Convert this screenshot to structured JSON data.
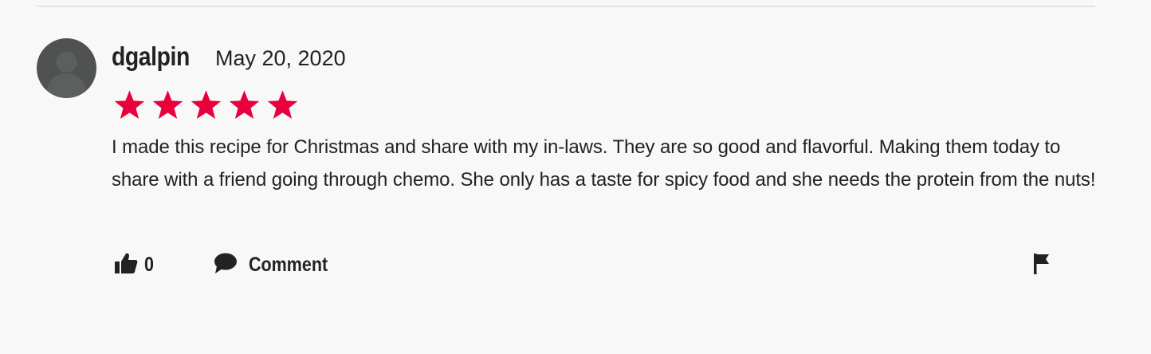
{
  "review": {
    "username": "dgalpin",
    "date": "May 20, 2020",
    "rating": 5,
    "rating_max": 5,
    "star_color": "#e8003d",
    "body": "I made this recipe for Christmas and share with my in-laws. They are so good and flavorful. Making them today to share with a friend going through chemo. She only has a taste for spicy food and she needs the protein from the nuts!"
  },
  "actions": {
    "like_icon": "thumbs-up-icon",
    "like_count": "0",
    "comment_icon": "speech-bubble-icon",
    "comment_label": "Comment",
    "flag_icon": "flag-icon"
  }
}
